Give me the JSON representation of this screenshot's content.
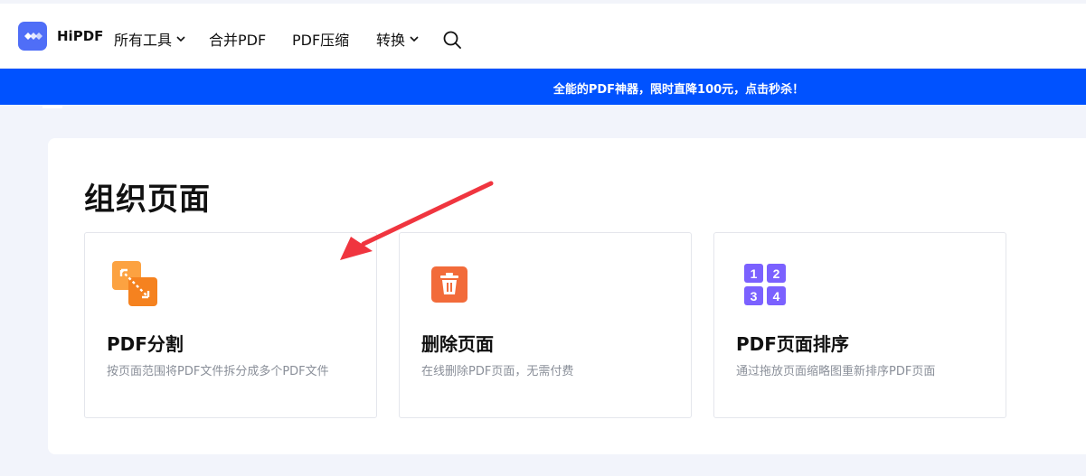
{
  "brand": {
    "name": "HiPDF",
    "color": "#4f6ef7"
  },
  "nav": {
    "items": [
      {
        "label": "所有工具",
        "dropdown": true
      },
      {
        "label": "合并PDF",
        "dropdown": false
      },
      {
        "label": "PDF压缩",
        "dropdown": false
      },
      {
        "label": "转换",
        "dropdown": true
      }
    ],
    "search_icon": "search-icon"
  },
  "banner": {
    "text": "全能的PDF神器，限时直降100元，点击秒杀！",
    "color": "#0052ff"
  },
  "section": {
    "title": "组织页面",
    "cards": [
      {
        "title": "PDF分割",
        "desc": "按页面范围将PDF文件拆分成多个PDF文件",
        "icon": "split-icon",
        "accent": "#f5821f"
      },
      {
        "title": "删除页面",
        "desc": "在线删除PDF页面，无需付费",
        "icon": "trash-icon",
        "accent": "#f26b3a"
      },
      {
        "title": "PDF页面排序",
        "desc": "通过拖放页面缩略图重新排序PDF页面",
        "icon": "page-order-icon",
        "accent": "#7b61ff",
        "icon_numbers": [
          "1",
          "2",
          "3",
          "4"
        ]
      }
    ]
  },
  "annotation": {
    "arrow_color": "#f0353f"
  }
}
